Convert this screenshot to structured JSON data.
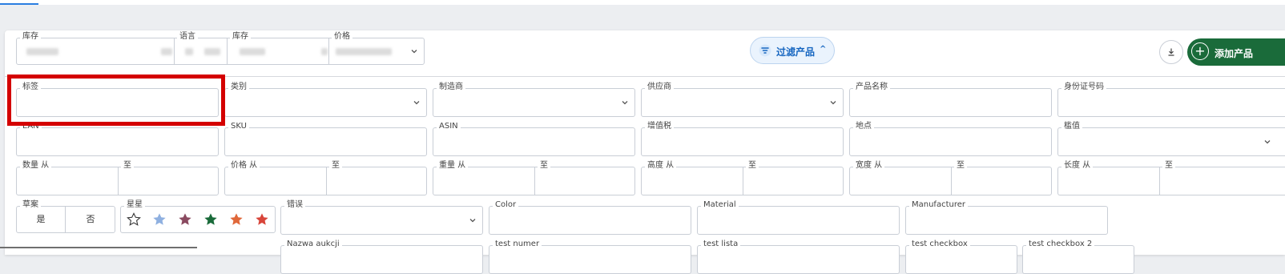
{
  "header_fields": [
    {
      "label": "库存",
      "value": ""
    },
    {
      "label": "语言",
      "value": ""
    },
    {
      "label": "库存",
      "value": ""
    },
    {
      "label": "价格",
      "value": ""
    }
  ],
  "toolbar": {
    "filter_label": "过滤产品",
    "filter_toggle": "^",
    "add_label": "添加产品",
    "add_icon": "+",
    "download_icon": "download-icon",
    "accent_color": "#1a6b3a",
    "filter_color": "#1565c0"
  },
  "filters": {
    "row1": [
      {
        "label": "标签",
        "type": "text"
      },
      {
        "label": "类别",
        "type": "select"
      },
      {
        "label": "制造商",
        "type": "select"
      },
      {
        "label": "供应商",
        "type": "select"
      },
      {
        "label": "产品名称",
        "type": "text"
      },
      {
        "label": "身份证号码",
        "type": "text"
      }
    ],
    "row2": [
      {
        "label": "EAN",
        "type": "text"
      },
      {
        "label": "SKU",
        "type": "text"
      },
      {
        "label": "ASIN",
        "type": "text"
      },
      {
        "label": "增值税",
        "type": "text"
      },
      {
        "label": "地点",
        "type": "text"
      },
      {
        "label": "槛值",
        "type": "select"
      }
    ],
    "row3": [
      {
        "from": "数量 从",
        "to": "至"
      },
      {
        "from": "价格 从",
        "to": "至"
      },
      {
        "from": "重量 从",
        "to": "至"
      },
      {
        "from": "高度 从",
        "to": "至"
      },
      {
        "from": "宽度 从",
        "to": "至"
      },
      {
        "from": "长度 从",
        "to": "至"
      }
    ],
    "draft": {
      "label": "草案",
      "yes": "是",
      "no": "否"
    },
    "stars": {
      "label": "星星",
      "colors": [
        "#ffffff",
        "#8fb0e0",
        "#8a4a60",
        "#1a6b3a",
        "#e0683a",
        "#d8453a"
      ]
    },
    "error": {
      "label": "错误"
    },
    "color": {
      "label": "Color"
    },
    "material": {
      "label": "Material"
    },
    "manufacturer": {
      "label": "Manufacturer"
    },
    "row5": [
      {
        "label": "Nazwa aukcji"
      },
      {
        "label": "test numer"
      },
      {
        "label": "test lista"
      },
      {
        "label": "test checkbox"
      },
      {
        "label": "test checkbox 2"
      }
    ]
  }
}
